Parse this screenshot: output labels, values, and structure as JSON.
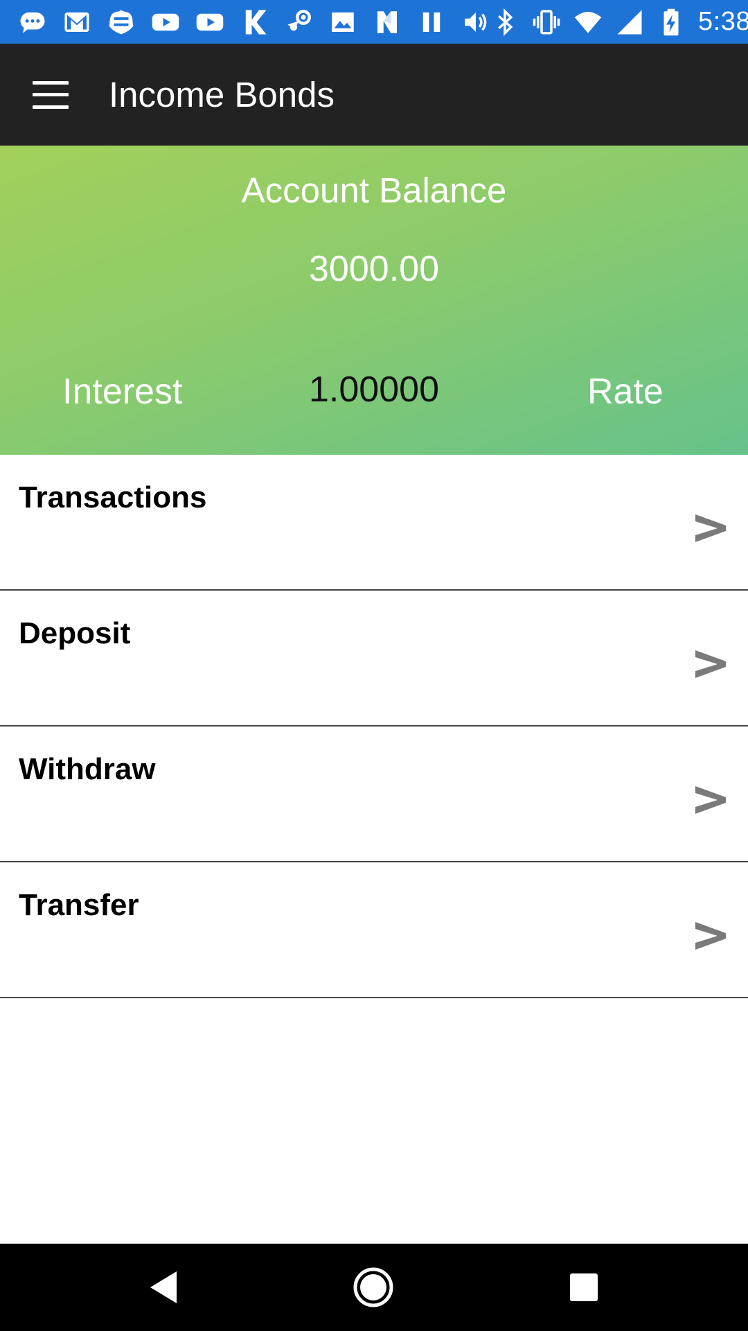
{
  "status_bar": {
    "time": "5:38",
    "left_icons": [
      "messages-icon",
      "gmail-icon",
      "webtoon-icon",
      "youtube-icon",
      "youtube-icon",
      "k-app-icon",
      "steam-icon",
      "gallery-icon",
      "nfc-icon",
      "pause-icon",
      "volume-icon"
    ],
    "right_icons": [
      "bluetooth-icon",
      "vibrate-icon",
      "wifi-icon",
      "signal-icon",
      "battery-charging-icon"
    ]
  },
  "app_bar": {
    "title": "Income Bonds"
  },
  "balance": {
    "label": "Account Balance",
    "value": "3000.00",
    "interest_label": "Interest",
    "interest_value": "1.00000",
    "rate_label": "Rate"
  },
  "menu": {
    "items": [
      {
        "label": "Transactions",
        "chevron": ">"
      },
      {
        "label": "Deposit",
        "chevron": ">"
      },
      {
        "label": "Withdraw",
        "chevron": ">"
      },
      {
        "label": "Transfer",
        "chevron": ">"
      }
    ]
  },
  "colors": {
    "status_bar": "#1e73d6",
    "app_bar": "#222222",
    "balance_gradient_start": "#a2d05a",
    "balance_gradient_end": "#66c28a",
    "chevron": "#7a7a7a",
    "nav_bar": "#000000"
  }
}
